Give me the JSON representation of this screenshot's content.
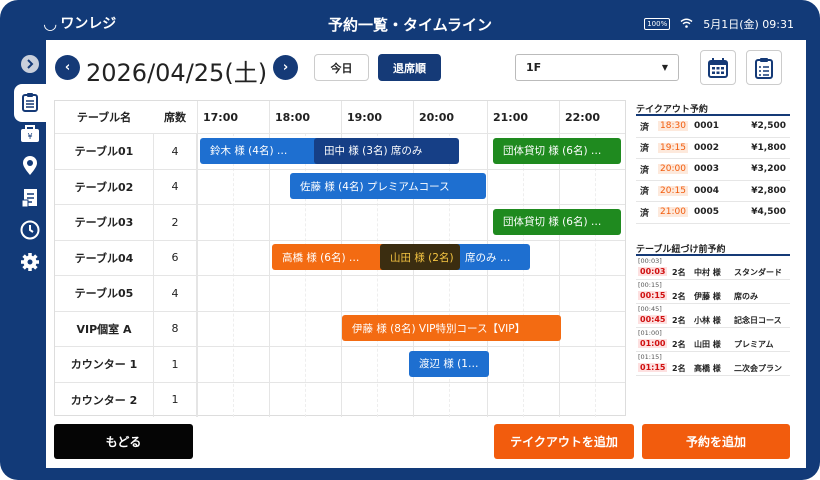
{
  "app": {
    "logo": "ワンレジ",
    "title": "予約一覧・タイムライン",
    "battery": "100%",
    "datetime": "5月1日(金) 09:31"
  },
  "toolbar": {
    "date": "2026/04/25(土)",
    "today": "今日",
    "order": "退席順",
    "floor": "1F"
  },
  "grid": {
    "headers": {
      "table": "テーブル名",
      "seats": "席数"
    },
    "times": [
      "17:00",
      "18:00",
      "19:00",
      "20:00",
      "21:00",
      "22:00"
    ],
    "rows": [
      {
        "name": "テーブル01",
        "seats": "4"
      },
      {
        "name": "テーブル02",
        "seats": "4"
      },
      {
        "name": "テーブル03",
        "seats": "2"
      },
      {
        "name": "テーブル04",
        "seats": "6"
      },
      {
        "name": "テーブル05",
        "seats": "4"
      },
      {
        "name": "VIP個室 A",
        "seats": "8"
      },
      {
        "name": "カウンター 1",
        "seats": "1"
      },
      {
        "name": "カウンター 2",
        "seats": "1"
      }
    ]
  },
  "reservations": [
    {
      "label": "鈴木 様 (4名) …",
      "color": "#1e6fd0"
    },
    {
      "label": "田中 様 (3名) 席のみ",
      "color": "#163f86"
    },
    {
      "label": "団体貸切 様 (6名) …",
      "color": "#1f8a1f"
    },
    {
      "label": "佐藤 様 (4名) プレミアムコース",
      "color": "#1e6fd0"
    },
    {
      "label": "団体貸切 様 (6名) …",
      "color": "#1f8a1f"
    },
    {
      "label": "高橋 様 (6名) …",
      "color": "#f36b12"
    },
    {
      "label": "山田 様 (2名)",
      "color": "#3b2d10"
    },
    {
      "label": "席のみ …",
      "color": "#1e6fd0"
    },
    {
      "label": "伊藤 様 (8名) VIP特別コース【VIP】",
      "color": "#f36b12"
    },
    {
      "label": "渡辺 様 (1…",
      "color": "#1e6fd0"
    }
  ],
  "takeout": {
    "title": "テイクアウト予約",
    "items": [
      {
        "status": "済",
        "time": "18:30",
        "no": "0001",
        "price": "¥2,500"
      },
      {
        "status": "済",
        "time": "19:15",
        "no": "0002",
        "price": "¥1,800"
      },
      {
        "status": "済",
        "time": "20:00",
        "no": "0003",
        "price": "¥3,200"
      },
      {
        "status": "済",
        "time": "20:15",
        "no": "0004",
        "price": "¥2,800"
      },
      {
        "status": "済",
        "time": "21:00",
        "no": "0005",
        "price": "¥4,500"
      }
    ]
  },
  "unassigned": {
    "title": "テーブル紐づけ前予約",
    "items": [
      {
        "wait": "[00:03]",
        "time": "00:03",
        "people": "2名",
        "name": "中村 様",
        "course": "スタンダード"
      },
      {
        "wait": "[00:15]",
        "time": "00:15",
        "people": "2名",
        "name": "伊藤 様",
        "course": "席のみ"
      },
      {
        "wait": "[00:45]",
        "time": "00:45",
        "people": "2名",
        "name": "小林 様",
        "course": "記念日コース"
      },
      {
        "wait": "[01:00]",
        "time": "01:00",
        "people": "2名",
        "name": "山田 様",
        "course": "プレミアム"
      },
      {
        "wait": "[01:15]",
        "time": "01:15",
        "people": "2名",
        "name": "高橋 様",
        "course": "二次会プラン"
      }
    ]
  },
  "footer": {
    "back": "もどる",
    "add_takeout": "テイクアウトを追加",
    "add_reservation": "予約を追加"
  },
  "colors": {
    "navy": "#153a77",
    "orange": "#f25c0d",
    "black": "#050505",
    "accent_red": "#d01010"
  }
}
